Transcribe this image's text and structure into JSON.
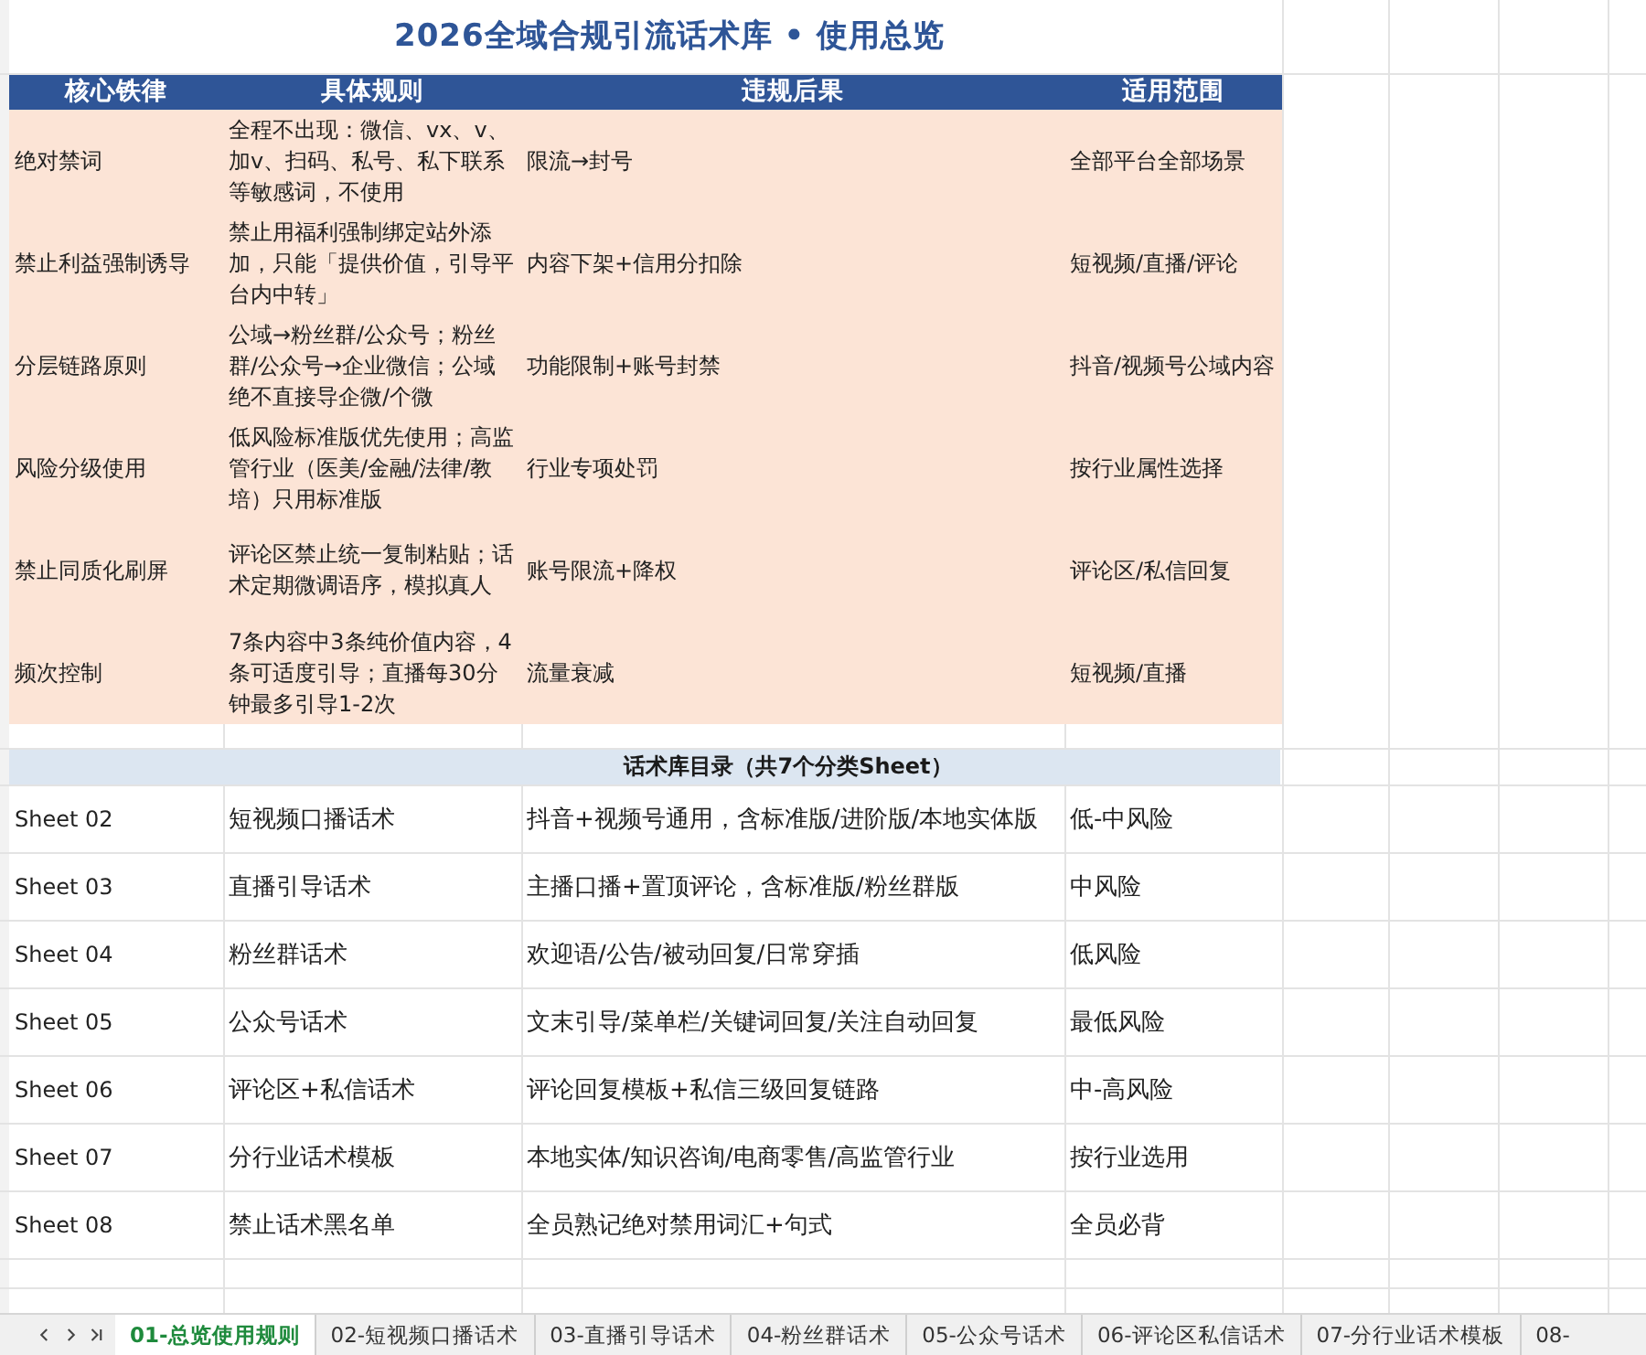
{
  "title": "2026全域合规引流话术库 • 使用总览",
  "rules_table": {
    "columns": [
      "核心铁律",
      "具体规则",
      "违规后果",
      "适用范围"
    ],
    "rows": [
      {
        "rule": "绝对禁词",
        "detail": "全程不出现：微信、vx、v、加v、扫码、私号、私下联系等敏感词，不使用",
        "penalty": "限流→封号",
        "scope": "全部平台全部场景"
      },
      {
        "rule": "禁止利益强制诱导",
        "detail": "禁止用福利强制绑定站外添加，只能「提供价值，引导平台内中转」",
        "penalty": "内容下架+信用分扣除",
        "scope": "短视频/直播/评论"
      },
      {
        "rule": "分层链路原则",
        "detail": "公域→粉丝群/公众号；粉丝群/公众号→企业微信；公域绝不直接导企微/个微",
        "penalty": "功能限制+账号封禁",
        "scope": "抖音/视频号公域内容"
      },
      {
        "rule": "风险分级使用",
        "detail": "低风险标准版优先使用；高监管行业（医美/金融/法律/教培）只用标准版",
        "penalty": "行业专项处罚",
        "scope": "按行业属性选择"
      },
      {
        "rule": "禁止同质化刷屏",
        "detail": "评论区禁止统一复制粘贴；话术定期微调语序，模拟真人",
        "penalty": "账号限流+降权",
        "scope": "评论区/私信回复"
      },
      {
        "rule": "频次控制",
        "detail": "7条内容中3条纯价值内容，4条可适度引导；直播每30分钟最多引导1-2次",
        "penalty": "流量衰减",
        "scope": "短视频/直播"
      }
    ]
  },
  "catalog": {
    "title": "话术库目录（共7个分类Sheet）",
    "rows": [
      {
        "sheet": "Sheet 02",
        "name": "短视频口播话术",
        "content": "抖音+视频号通用，含标准版/进阶版/本地实体版",
        "risk": "低-中风险"
      },
      {
        "sheet": "Sheet 03",
        "name": "直播引导话术",
        "content": "主播口播+置顶评论，含标准版/粉丝群版",
        "risk": "中风险"
      },
      {
        "sheet": "Sheet 04",
        "name": "粉丝群话术",
        "content": "欢迎语/公告/被动回复/日常穿插",
        "risk": "低风险"
      },
      {
        "sheet": "Sheet 05",
        "name": "公众号话术",
        "content": "文末引导/菜单栏/关键词回复/关注自动回复",
        "risk": "最低风险"
      },
      {
        "sheet": "Sheet 06",
        "name": "评论区+私信话术",
        "content": "评论回复模板+私信三级回复链路",
        "risk": "中-高风险"
      },
      {
        "sheet": "Sheet 07",
        "name": "分行业话术模板",
        "content": "本地实体/知识咨询/电商零售/高监管行业",
        "risk": "按行业选用"
      },
      {
        "sheet": "Sheet 08",
        "name": "禁止话术黑名单",
        "content": "全员熟记绝对禁用词汇+句式",
        "risk": "全员必背"
      }
    ]
  },
  "sheet_tabs": [
    {
      "label": "01-总览使用规则",
      "selected": true
    },
    {
      "label": "02-短视频口播话术",
      "selected": false
    },
    {
      "label": "03-直播引导话术",
      "selected": false
    },
    {
      "label": "04-粉丝群话术",
      "selected": false
    },
    {
      "label": "05-公众号话术",
      "selected": false
    },
    {
      "label": "06-评论区私信话术",
      "selected": false
    },
    {
      "label": "07-分行业话术模板",
      "selected": false
    },
    {
      "label": "08-",
      "selected": false
    }
  ]
}
